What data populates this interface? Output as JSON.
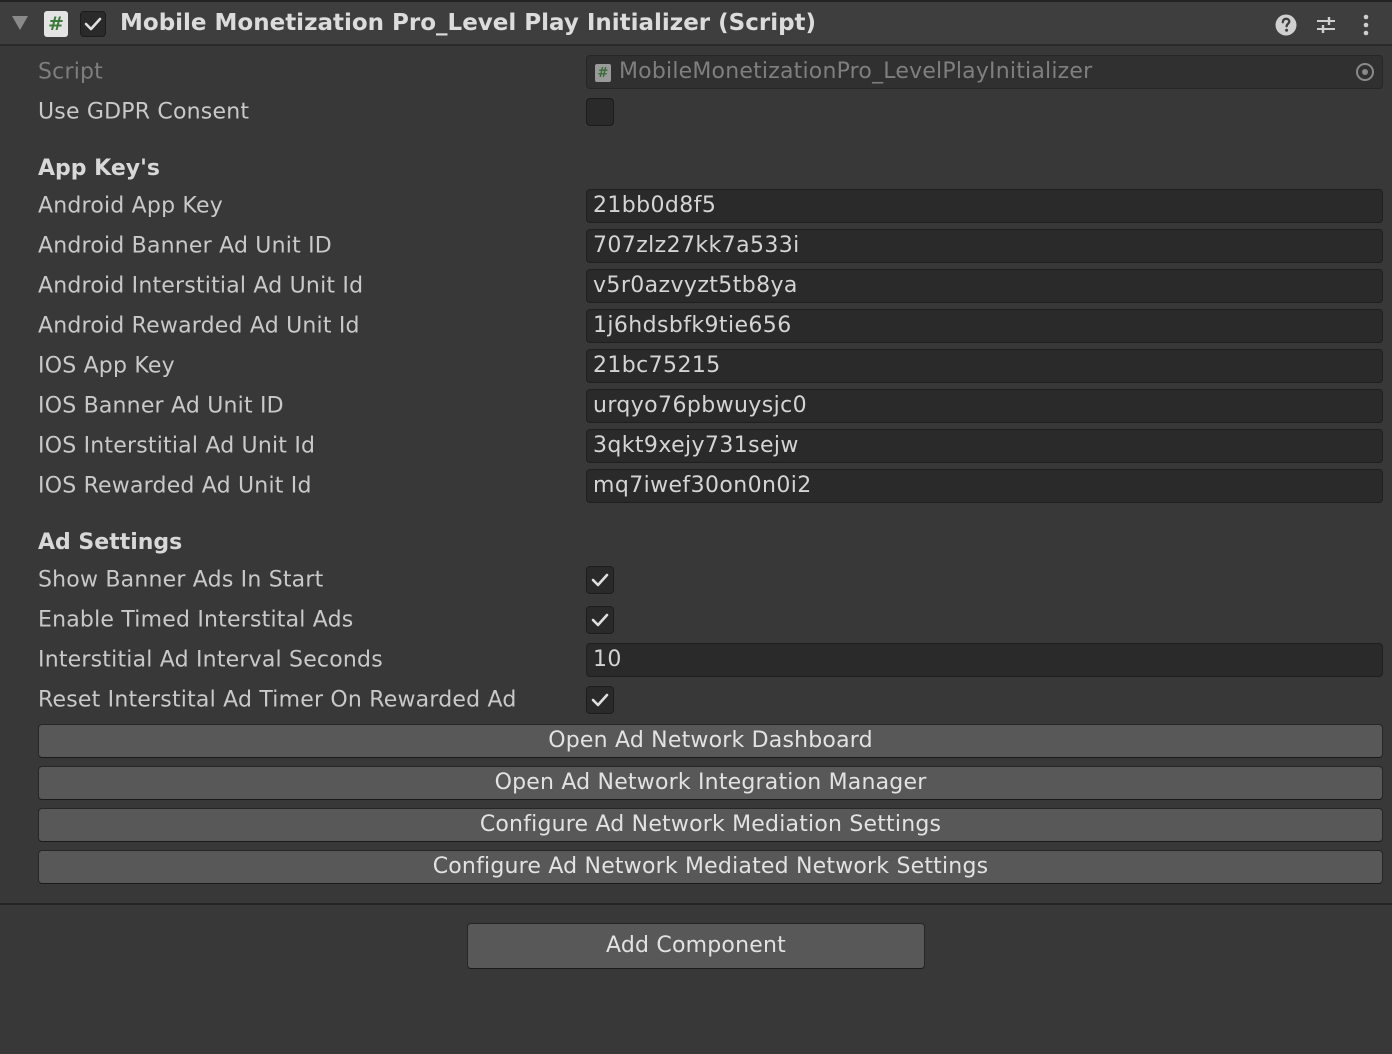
{
  "component": {
    "title": "Mobile Monetization Pro_Level Play Initializer (Script)",
    "icon": "script-icon",
    "script_icon_glyph": "#",
    "enabled": true
  },
  "script_field": {
    "label": "Script",
    "value": "MobileMonetizationPro_LevelPlayInitializer"
  },
  "gdpr": {
    "label": "Use GDPR Consent",
    "checked": false
  },
  "app_keys": {
    "title": "App Key's",
    "fields": [
      {
        "label": "Android App Key",
        "value": "21bb0d8f5"
      },
      {
        "label": "Android Banner Ad Unit ID",
        "value": "707zlz27kk7a533i"
      },
      {
        "label": "Android Interstitial Ad Unit Id",
        "value": "v5r0azvyzt5tb8ya"
      },
      {
        "label": "Android Rewarded Ad Unit Id",
        "value": "1j6hdsbfk9tie656"
      },
      {
        "label": "IOS App Key",
        "value": "21bc75215"
      },
      {
        "label": "IOS Banner Ad Unit ID",
        "value": "urqyo76pbwuysjc0"
      },
      {
        "label": "IOS Interstitial Ad Unit Id",
        "value": "3qkt9xejy731sejw"
      },
      {
        "label": "IOS Rewarded Ad Unit Id",
        "value": "mq7iwef30on0n0i2"
      }
    ]
  },
  "ad_settings": {
    "title": "Ad Settings",
    "show_banner": {
      "label": "Show Banner Ads In Start",
      "checked": true
    },
    "timed_interstitial": {
      "label": "Enable Timed Interstital Ads",
      "checked": true
    },
    "interval": {
      "label": "Interstitial Ad Interval Seconds",
      "value": "10"
    },
    "reset_timer": {
      "label": "Reset Interstital Ad Timer On Rewarded Ad",
      "checked": true
    }
  },
  "buttons": {
    "dashboard": "Open Ad Network Dashboard",
    "integration_manager": "Open Ad Network Integration Manager",
    "mediation_settings": "Configure Ad Network Mediation Settings",
    "mediated_network_settings": "Configure Ad Network Mediated Network Settings"
  },
  "add_component": "Add Component",
  "colors": {
    "background": "#383838",
    "field": "#2a2a2a",
    "button": "#585858",
    "script_icon_green": "#3b7a3b"
  }
}
